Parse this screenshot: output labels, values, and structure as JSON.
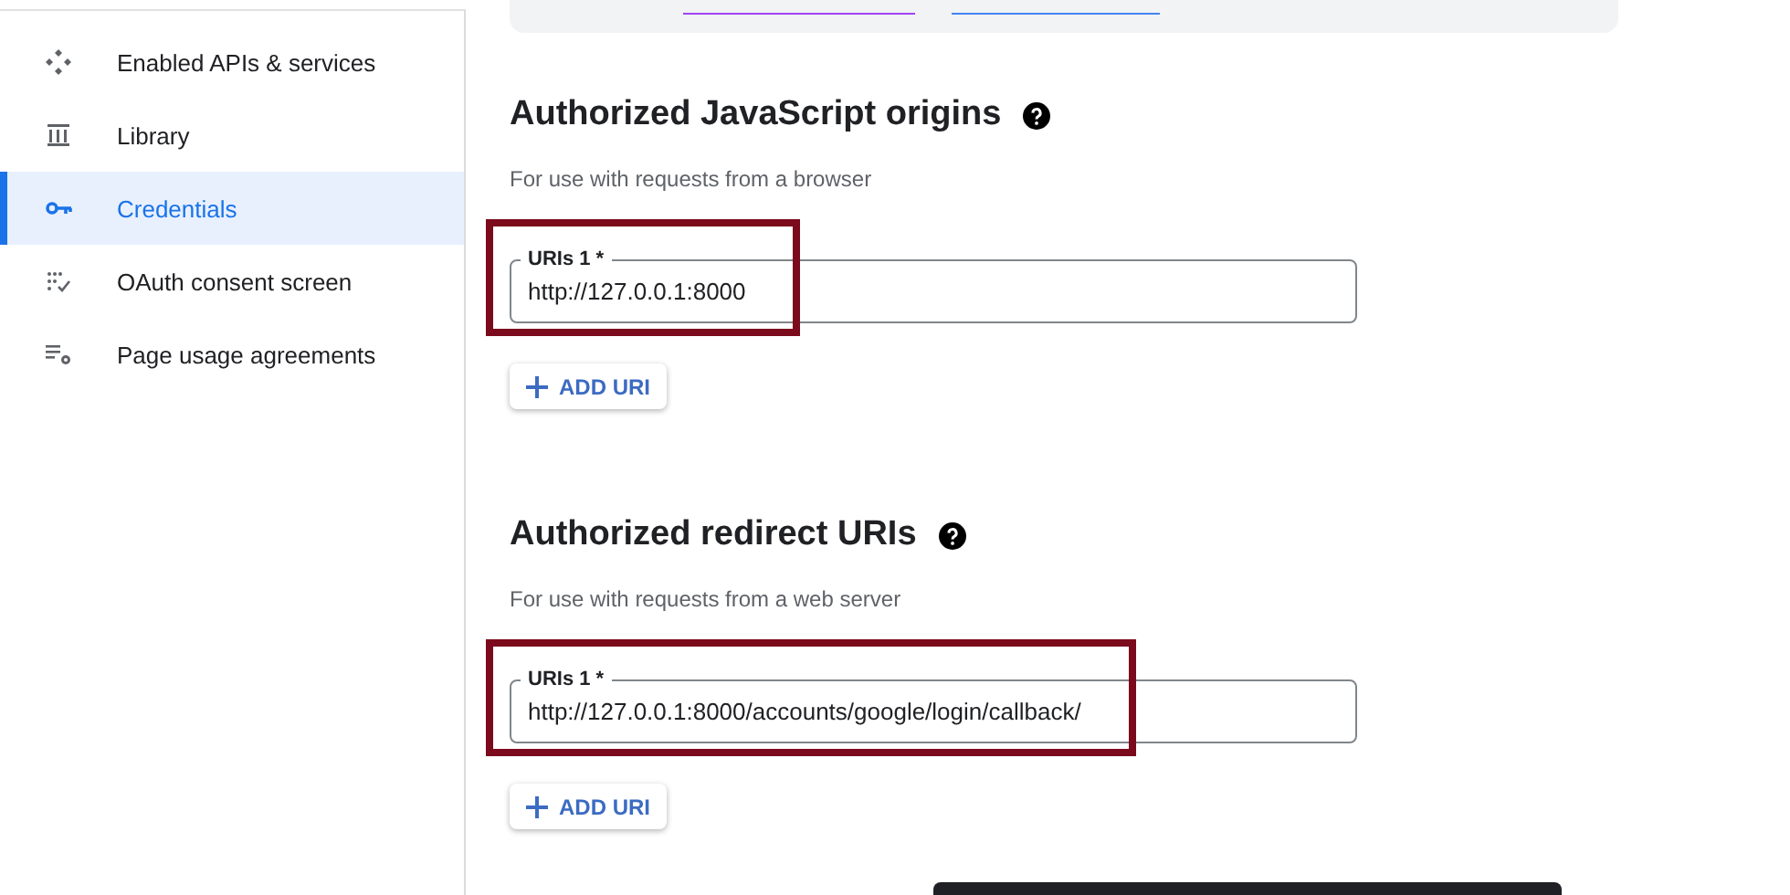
{
  "sidebar": {
    "items": [
      {
        "label": "Enabled APIs & services",
        "selected": false
      },
      {
        "label": "Library",
        "selected": false
      },
      {
        "label": "Credentials",
        "selected": true
      },
      {
        "label": "OAuth consent screen",
        "selected": false
      },
      {
        "label": "Page usage agreements",
        "selected": false
      }
    ]
  },
  "sections": [
    {
      "title": "Authorized JavaScript origins",
      "description": "For use with requests from a browser",
      "uris": [
        {
          "label": "URIs 1 *",
          "value": "http://127.0.0.1:8000",
          "highlighted": true
        }
      ],
      "add_button": "ADD URI"
    },
    {
      "title": "Authorized redirect URIs",
      "description": "For use with requests from a web server",
      "uris": [
        {
          "label": "URIs 1 *",
          "value": "http://127.0.0.1:8000/accounts/google/login/callback/",
          "highlighted": true
        }
      ],
      "add_button": "ADD URI"
    }
  ]
}
